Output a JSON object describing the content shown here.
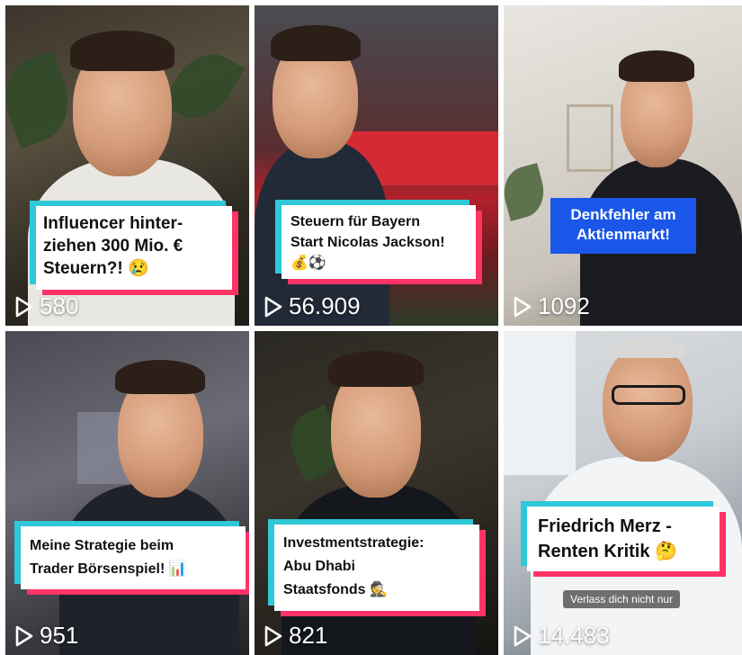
{
  "videos": [
    {
      "caption_lines": [
        "Influencer hinter-",
        "ziehen 300 Mio. €",
        "Steuern?! 😢"
      ],
      "views": "580"
    },
    {
      "caption_lines": [
        "Steuern für Bayern",
        "Start Nicolas Jackson!",
        "💰⚽"
      ],
      "views": "56.909"
    },
    {
      "caption_lines": [
        "Denkfehler am",
        "Aktienmarkt!"
      ],
      "views": "1092"
    },
    {
      "caption_lines": [
        "Meine Strategie beim",
        "Trader Börsenspiel! 📊"
      ],
      "views": "951"
    },
    {
      "caption_lines": [
        "Investmentstrategie:",
        "Abu Dhabi",
        "Staatsfonds 🕵️"
      ],
      "views": "821"
    },
    {
      "caption_lines": [
        "Friedrich Merz -",
        "Renten Kritik 🤔"
      ],
      "views": "14.483",
      "subtitle": "Verlass dich nicht nur"
    }
  ],
  "colors": {
    "caption_border_top": "#2ec8d8",
    "caption_border_bottom": "#ff3366",
    "caption_blue": "#1a56e8"
  },
  "icons": {
    "views": "play-outline-icon"
  }
}
